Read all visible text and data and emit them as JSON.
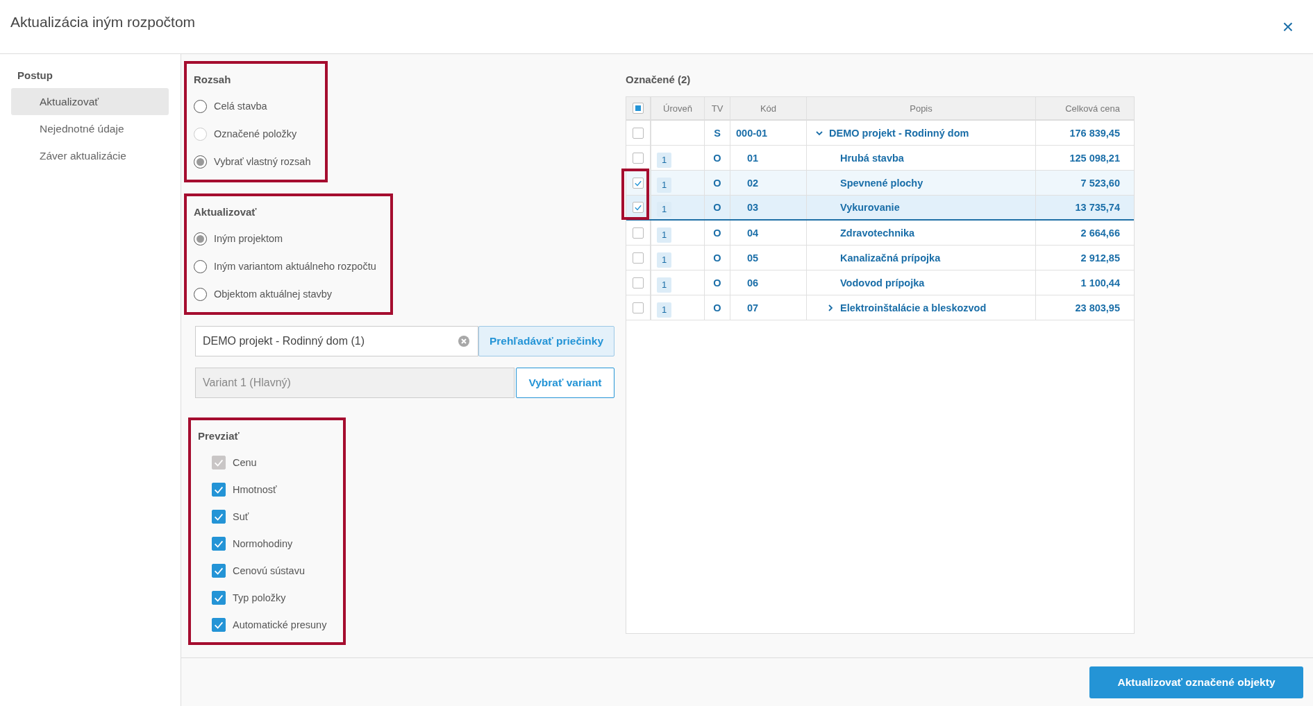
{
  "dialog": {
    "title": "Aktualizácia iným rozpočtom",
    "close": "×"
  },
  "sidebar": {
    "heading": "Postup",
    "items": [
      {
        "label": "Aktualizovať",
        "selected": true
      },
      {
        "label": "Nejednotné údaje",
        "selected": false
      },
      {
        "label": "Záver aktualizácie",
        "selected": false
      }
    ]
  },
  "scope": {
    "heading": "Rozsah",
    "highlighted": true,
    "options": [
      {
        "label": "Celá stavba",
        "selected": false,
        "disabled": false
      },
      {
        "label": "Označené položky",
        "selected": false,
        "disabled": true
      },
      {
        "label": "Vybrať vlastný rozsah",
        "selected": true,
        "disabled": false
      }
    ]
  },
  "update_with": {
    "heading": "Aktualizovať",
    "highlighted": true,
    "options": [
      {
        "label": "Iným projektom",
        "selected": true,
        "disabled": false
      },
      {
        "label": "Iným variantom aktuálneho rozpočtu",
        "selected": false,
        "disabled": false
      },
      {
        "label": "Objektom aktuálnej stavby",
        "selected": false,
        "disabled": false
      }
    ]
  },
  "project_field": {
    "value": "DEMO projekt - Rodinný dom (1)",
    "button": "Prehľadávať priečinky"
  },
  "variant_field": {
    "value": "Variant 1 (Hlavný)",
    "button": "Vybrať variant"
  },
  "take_over": {
    "heading": "Prevziať",
    "highlighted": true,
    "options": [
      {
        "label": "Cenu",
        "checked": true,
        "disabled": true
      },
      {
        "label": "Hmotnosť",
        "checked": true,
        "disabled": false
      },
      {
        "label": "Suť",
        "checked": true,
        "disabled": false
      },
      {
        "label": "Normohodiny",
        "checked": true,
        "disabled": false
      },
      {
        "label": "Cenovú sústavu",
        "checked": true,
        "disabled": false
      },
      {
        "label": "Typ položky",
        "checked": true,
        "disabled": false
      },
      {
        "label": "Automatické presuny",
        "checked": true,
        "disabled": false
      }
    ]
  },
  "marked": {
    "heading": "Označené (2)",
    "select_all": {
      "checked": false,
      "indeterminate": true
    },
    "columns": [
      "Úroveň",
      "TV",
      "Kód",
      "Popis",
      "Celková cena"
    ],
    "rows": [
      {
        "level": "",
        "tv": "S",
        "code": "000-01",
        "description": "DEMO projekt - Rodinný dom",
        "price": "176 839,45",
        "checked": false,
        "current": false,
        "highlighted": false,
        "expanded": true,
        "children": [
          {
            "level": "1",
            "tv": "O",
            "code": "01",
            "description": "Hrubá stavba",
            "price": "125 098,21",
            "checked": false,
            "current": false,
            "highlighted": false
          },
          {
            "level": "1",
            "tv": "O",
            "code": "02",
            "description": "Spevnené plochy",
            "price": "7 523,60",
            "checked": true,
            "current": false,
            "highlighted": true
          },
          {
            "level": "1",
            "tv": "O",
            "code": "03",
            "description": "Vykurovanie",
            "price": "13 735,74",
            "checked": true,
            "current": true,
            "highlighted": true
          },
          {
            "level": "1",
            "tv": "O",
            "code": "04",
            "description": "Zdravotechnika",
            "price": "2 664,66",
            "checked": false,
            "current": false,
            "highlighted": false
          },
          {
            "level": "1",
            "tv": "O",
            "code": "05",
            "description": "Kanalizačná prípojka",
            "price": "2 912,85",
            "checked": false,
            "current": false,
            "highlighted": false
          },
          {
            "level": "1",
            "tv": "O",
            "code": "06",
            "description": "Vodovod prípojka",
            "price": "1 100,44",
            "checked": false,
            "current": false,
            "highlighted": false
          },
          {
            "level": "1",
            "tv": "O",
            "code": "07",
            "description": "Elektroinštalácie a bleskozvod",
            "price": "23 803,95",
            "checked": false,
            "current": false,
            "highlighted": false,
            "expanded": false
          }
        ]
      }
    ]
  },
  "footer": {
    "button": "Aktualizovať označené objekty"
  }
}
